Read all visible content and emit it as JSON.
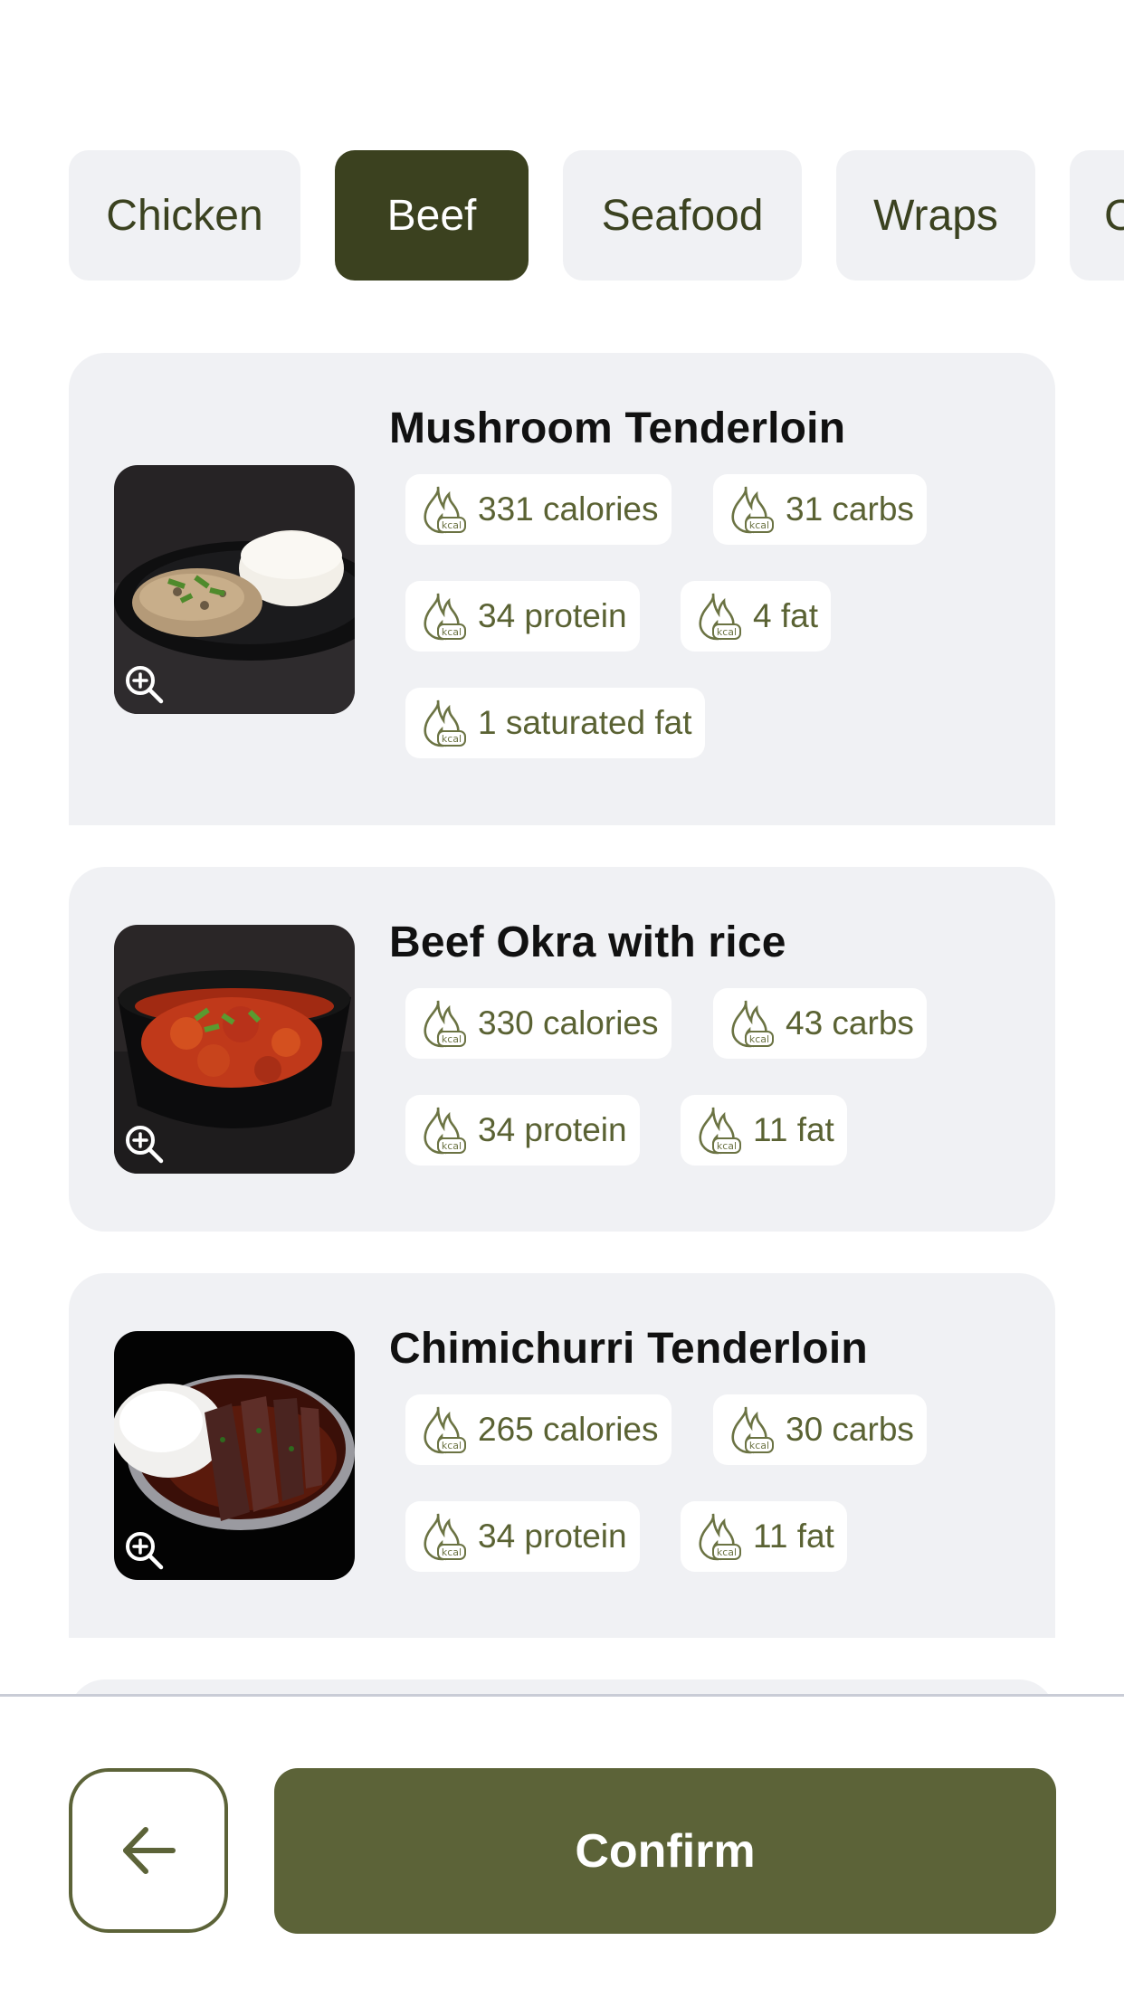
{
  "categories": {
    "items": [
      {
        "label": "Chicken",
        "active": false
      },
      {
        "label": "Beef",
        "active": true
      },
      {
        "label": "Seafood",
        "active": false
      },
      {
        "label": "Wraps",
        "active": false
      },
      {
        "label": "C",
        "active": false
      }
    ]
  },
  "meals": [
    {
      "name": "Mushroom Tenderloin",
      "image_icon": "magnify-plus-icon",
      "nutrition": [
        "331 calories",
        "31 carbs",
        "34 protein",
        "4 fat",
        "1 saturated fat"
      ]
    },
    {
      "name": "Beef Okra with rice",
      "image_icon": "magnify-plus-icon",
      "nutrition": [
        "330 calories",
        "43 carbs",
        "34 protein",
        "11 fat"
      ]
    },
    {
      "name": "Chimichurri Tenderloin",
      "image_icon": "magnify-plus-icon",
      "nutrition": [
        "265 calories",
        "30 carbs",
        "34 protein",
        "11 fat"
      ]
    }
  ],
  "footer": {
    "back_icon": "arrow-left-icon",
    "confirm_label": "Confirm"
  },
  "colors": {
    "brand_dark": "#3b411f",
    "brand": "#5c6338",
    "card_bg": "#f0f1f4",
    "chip_text": "#5a6233"
  }
}
